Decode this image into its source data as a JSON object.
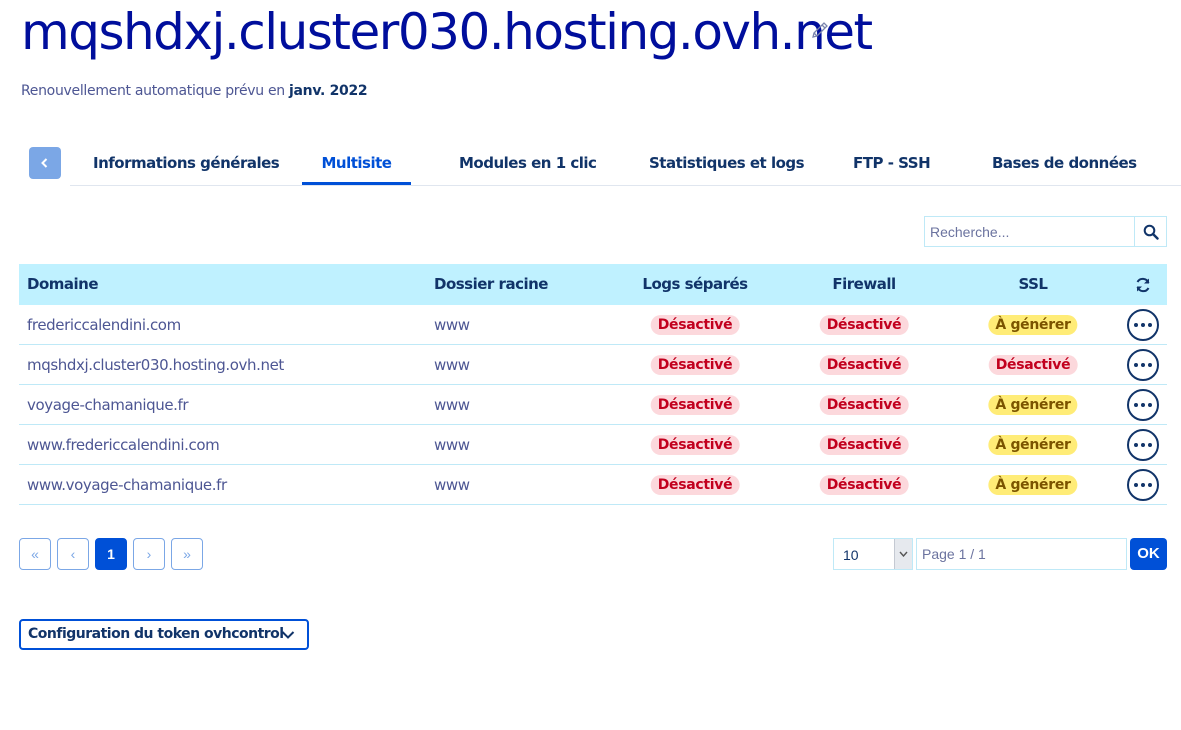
{
  "header": {
    "title": "mqshdxj.cluster030.hosting.ovh.net",
    "renewal_text": "Renouvellement automatique prévu en ",
    "renewal_date": "janv. 2022"
  },
  "tabs": [
    {
      "label": "Informations générales",
      "active": false
    },
    {
      "label": "Multisite",
      "active": true
    },
    {
      "label": "Modules en 1 clic",
      "active": false
    },
    {
      "label": "Statistiques et logs",
      "active": false
    },
    {
      "label": "FTP - SSH",
      "active": false
    },
    {
      "label": "Bases de données",
      "active": false
    }
  ],
  "search": {
    "placeholder": "Recherche..."
  },
  "table": {
    "headers": [
      "Domaine",
      "Dossier racine",
      "Logs séparés",
      "Firewall",
      "SSL"
    ],
    "rows": [
      {
        "domain": "fredericcalendini.com",
        "root": "www",
        "logs": "Désactivé",
        "firewall": "Désactivé",
        "ssl": "À générer"
      },
      {
        "domain": "mqshdxj.cluster030.hosting.ovh.net",
        "root": "www",
        "logs": "Désactivé",
        "firewall": "Désactivé",
        "ssl": "Désactivé"
      },
      {
        "domain": "voyage-chamanique.fr",
        "root": "www",
        "logs": "Désactivé",
        "firewall": "Désactivé",
        "ssl": "À générer"
      },
      {
        "domain": "www.fredericcalendini.com",
        "root": "www",
        "logs": "Désactivé",
        "firewall": "Désactivé",
        "ssl": "À générer"
      },
      {
        "domain": "www.voyage-chamanique.fr",
        "root": "www",
        "logs": "Désactivé",
        "firewall": "Désactivé",
        "ssl": "À générer"
      }
    ]
  },
  "pagination": {
    "first": "«",
    "prev": "‹",
    "current": "1",
    "next": "›",
    "last": "»",
    "page_size": "10",
    "page_placeholder": "Page 1 / 1",
    "ok_label": "OK"
  },
  "token": {
    "label": "Configuration du token ovhcontrol"
  },
  "colors": {
    "primary": "#0050d7",
    "text_dark": "#113469",
    "header_bg": "#bff1ff",
    "badge_red_bg": "#fcd8dc",
    "badge_red_text": "#c2001e",
    "badge_yellow_bg": "#ffec77"
  },
  "icons": [
    "pencil-icon",
    "chevron-left-icon",
    "search-icon",
    "refresh-icon",
    "more-icon",
    "chevron-down-icon"
  ]
}
